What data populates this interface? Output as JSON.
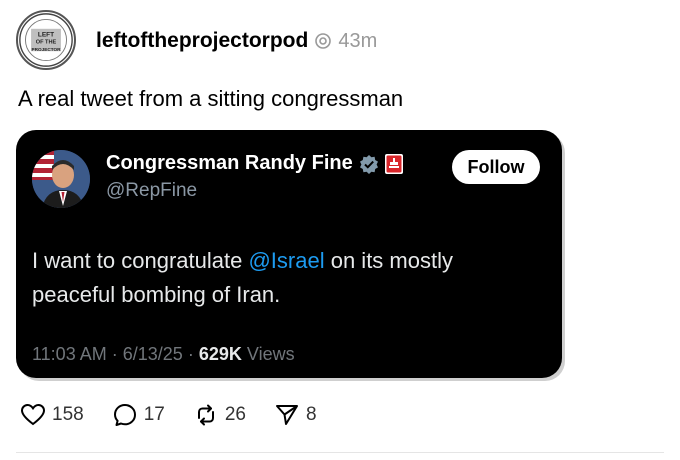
{
  "post": {
    "username": "leftoftheprojectorpod",
    "timestamp": "43m",
    "text": "A real tweet from a sitting congressman",
    "avatar_text": [
      "LEFT",
      "OF THE",
      "PROJECTOR"
    ]
  },
  "embed": {
    "display_name": "Congressman Randy Fine",
    "handle": "@RepFine",
    "follow_label": "Follow",
    "body_before": "I want to congratulate ",
    "mention": "@Israel",
    "body_after": " on its mostly peaceful bombing of Iran.",
    "time": "11:03 AM",
    "date": "6/13/25",
    "views_count": "629K",
    "views_label": "Views"
  },
  "actions": {
    "likes": "158",
    "comments": "17",
    "reposts": "26",
    "shares": "8"
  },
  "icons": {
    "thread": "thread-icon",
    "verified": "verified-icon",
    "gov": "government-badge-icon",
    "like": "heart-icon",
    "comment": "comment-icon",
    "repost": "repost-icon",
    "share": "share-icon"
  },
  "colors": {
    "verified": "#829aab",
    "mention": "#1d9bf0",
    "gov_badge": "#d9252a"
  }
}
